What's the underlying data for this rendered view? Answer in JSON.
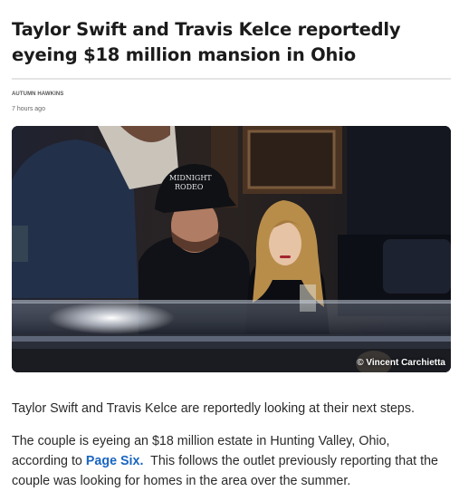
{
  "article": {
    "headline": "Taylor Swift and Travis Kelce reportedly eyeing $18 million mansion in Ohio",
    "author": "AUTUMN HAWKINS",
    "timestamp": "7 hours ago",
    "image": {
      "credit": "© Vincent Carchietta",
      "cap_text_line1": "MIDNIGHT",
      "cap_text_line2": "RODEO"
    },
    "paragraph1": "Taylor Swift and Travis Kelce are reportedly looking at their next steps.",
    "paragraph2_before": "The couple is eyeing an $18 million estate in Hunting Valley, Ohio, according to ",
    "paragraph2_link": "Page Six.",
    "paragraph2_after": "  This follows the outlet previously reporting that the couple was looking for homes in the area over the summer."
  },
  "colors": {
    "link": "#1a66c2",
    "divider": "#e4e4e4"
  }
}
